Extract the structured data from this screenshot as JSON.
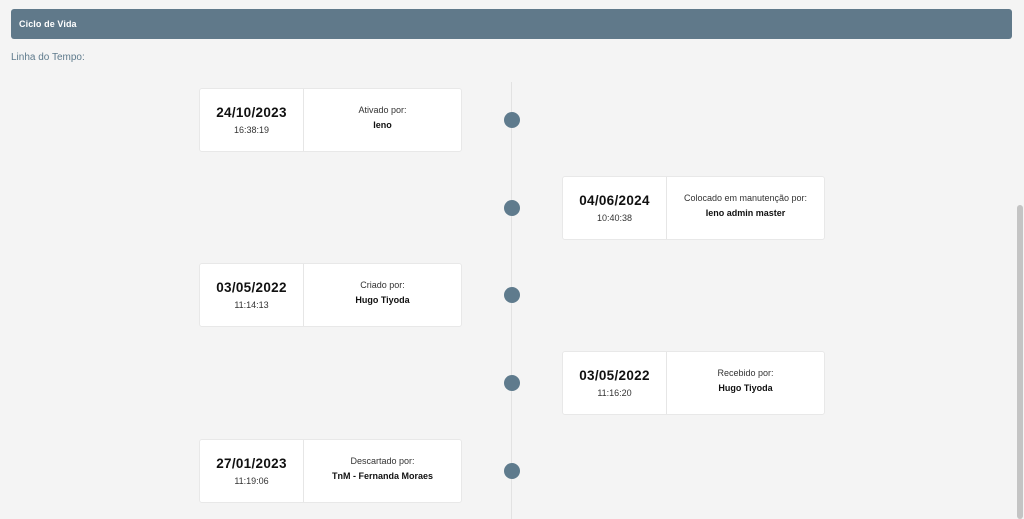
{
  "header": {
    "title": "Ciclo de Vida"
  },
  "timeline": {
    "label": "Linha do Tempo:",
    "events": [
      {
        "date": "24/10/2023",
        "time": "16:38:19",
        "action": "Ativado por:",
        "user": "Ieno"
      },
      {
        "date": "04/06/2024",
        "time": "10:40:38",
        "action": "Colocado em manutenção por:",
        "user": "Ieno admin master"
      },
      {
        "date": "03/05/2022",
        "time": "11:14:13",
        "action": "Criado por:",
        "user": "Hugo Tiyoda"
      },
      {
        "date": "03/05/2022",
        "time": "11:16:20",
        "action": "Recebido por:",
        "user": "Hugo Tiyoda"
      },
      {
        "date": "27/01/2023",
        "time": "11:19:06",
        "action": "Descartado por:",
        "user": "TnM - Fernanda Moraes"
      }
    ]
  },
  "colors": {
    "header_bg": "#60798a",
    "dot": "#5f7b8d",
    "label": "#5e7a8c"
  }
}
